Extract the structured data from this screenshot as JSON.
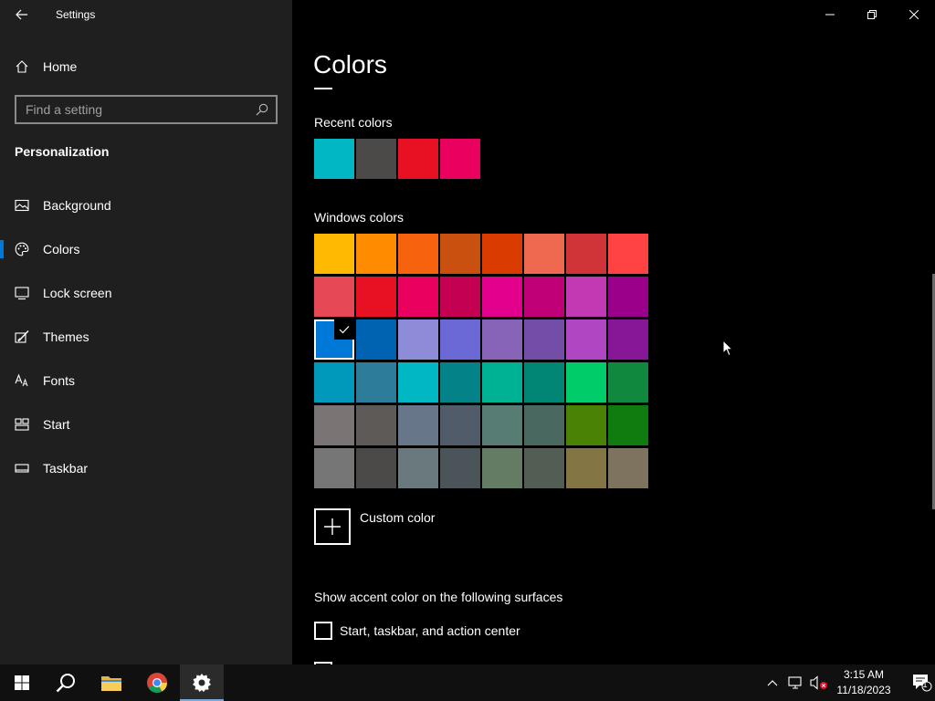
{
  "window": {
    "title": "Settings"
  },
  "sidebar": {
    "home_label": "Home",
    "search_placeholder": "Find a setting",
    "section_title": "Personalization",
    "items": [
      {
        "label": "Background",
        "icon": "image-icon",
        "selected": false
      },
      {
        "label": "Colors",
        "icon": "palette-icon",
        "selected": true
      },
      {
        "label": "Lock screen",
        "icon": "lock-screen-icon",
        "selected": false
      },
      {
        "label": "Themes",
        "icon": "brush-icon",
        "selected": false
      },
      {
        "label": "Fonts",
        "icon": "font-icon",
        "selected": false
      },
      {
        "label": "Start",
        "icon": "start-icon",
        "selected": false
      },
      {
        "label": "Taskbar",
        "icon": "taskbar-icon",
        "selected": false
      }
    ]
  },
  "main": {
    "title": "Colors",
    "recent_label": "Recent colors",
    "recent_colors": [
      "#00B7C3",
      "#4C4A48",
      "#E81123",
      "#EA005E"
    ],
    "windows_label": "Windows colors",
    "windows_colors": [
      [
        "#FFB900",
        "#FF8C00",
        "#F7630C",
        "#CA5010",
        "#DA3B01",
        "#EF6950",
        "#D13438",
        "#FF4343"
      ],
      [
        "#E74856",
        "#E81123",
        "#EA005E",
        "#C30052",
        "#E3008C",
        "#BF0077",
        "#C239B3",
        "#9A0089"
      ],
      [
        "#0078D7",
        "#0063B1",
        "#8E8CD8",
        "#6B69D6",
        "#8764B8",
        "#744DA9",
        "#B146C2",
        "#881798"
      ],
      [
        "#0099BC",
        "#2D7D9A",
        "#00B7C3",
        "#038387",
        "#00B294",
        "#018574",
        "#00CC6A",
        "#10893E"
      ],
      [
        "#7A7574",
        "#5D5A58",
        "#68768A",
        "#515C6B",
        "#567C73",
        "#486860",
        "#498205",
        "#107C10"
      ],
      [
        "#767676",
        "#4C4A48",
        "#69797E",
        "#4A5459",
        "#647C64",
        "#525E54",
        "#847545",
        "#7E735F"
      ]
    ],
    "selected_color": "#0078D7",
    "custom_color_label": "Custom color",
    "surfaces_label": "Show accent color on the following surfaces",
    "surface_option_1": "Start, taskbar, and action center",
    "surface_option_1_checked": false
  },
  "taskbar": {
    "time": "3:15 AM",
    "date": "11/18/2023",
    "notification_count": "1",
    "apps": [
      "start-icon",
      "search-icon",
      "file-explorer-icon",
      "chrome-icon",
      "settings-icon"
    ]
  }
}
